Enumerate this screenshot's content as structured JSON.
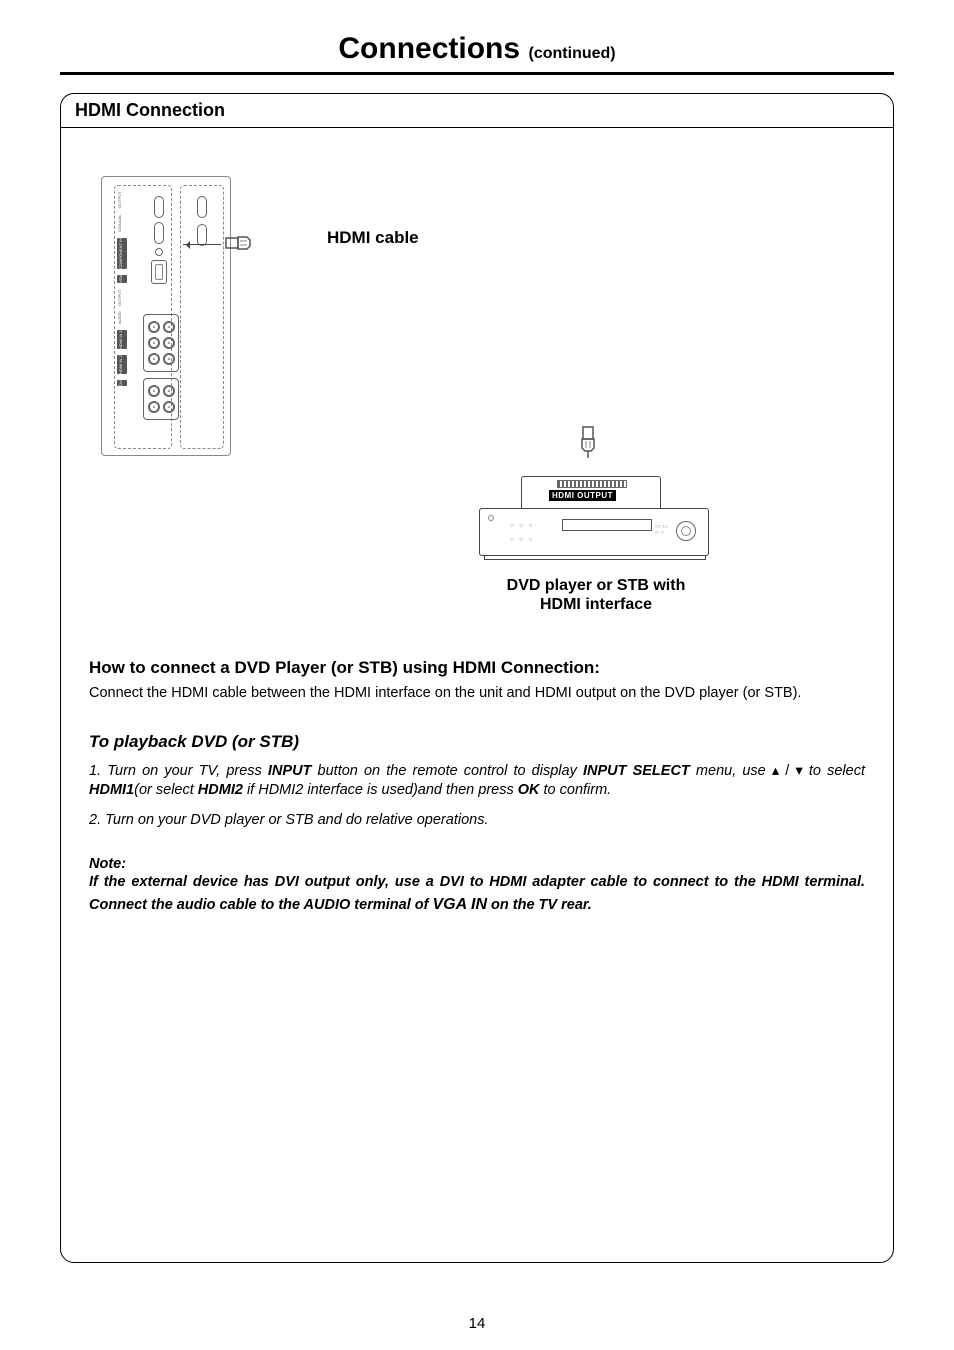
{
  "title": "Connections",
  "title_cont": "(continued)",
  "panel_header": "HDMI Connection",
  "diagram": {
    "hdmi_cable_label": "HDMI cable",
    "hdmi_output_label": "HDMI OUTPUT",
    "dvd_caption_line1": "DVD player or STB with",
    "dvd_caption_line2": "HDMI interface",
    "tv_labels": {
      "dvi": "DVI",
      "hdmi2": "HDMI IN 2",
      "hdmi1": "HDMI IN 1",
      "audio": "AUDIO",
      "output": "OUTPUT",
      "vga": "VGA",
      "component": "COMPONENT IN",
      "coaxial": "COAXIAL",
      "output2": "OUTPUT"
    }
  },
  "how_heading": "How to connect a DVD Player (or STB) using HDMI Connection:",
  "how_text": "Connect the HDMI cable between the HDMI interface on the unit and HDMI output on the DVD player (or STB).",
  "play_heading": "To playback DVD (or STB)",
  "step1_a": "1. Turn on your TV, press ",
  "step1_input": "INPUT",
  "step1_b": " button on the remote control to display ",
  "step1_select": "INPUT SELECT",
  "step1_c": " menu, use  ",
  "step1_arrows": "▴ / ▾",
  "step1_d": " to select ",
  "step1_hdmi1": "HDMI1",
  "step1_e": "(or select ",
  "step1_hdmi2": "HDMI2",
  "step1_f": " if HDMI2 interface is used)and then press ",
  "step1_ok": "OK",
  "step1_g": " to confirm.",
  "step2": "2. Turn on your DVD player or STB and do relative operations.",
  "note_label": "Note:",
  "note_a": "If the external device has DVI output only,  use a DVI to HDMI adapter cable to connect to the HDMI terminal.  Connect the audio cable to the AUDIO terminal of ",
  "note_vga": "VGA IN",
  "note_b": " on the TV rear.",
  "page_number": "14"
}
